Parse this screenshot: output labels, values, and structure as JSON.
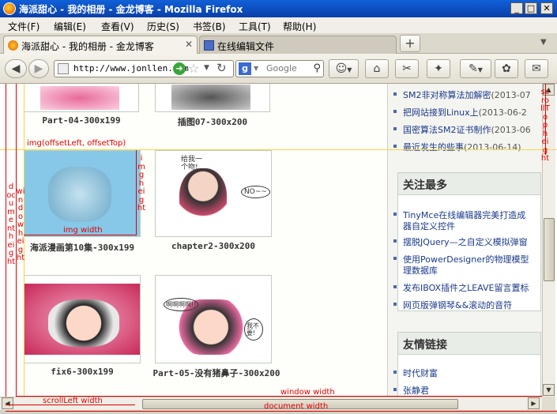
{
  "window": {
    "title": "海派甜心 - 我的相册 - 金龙博客 - Mozilla Firefox"
  },
  "menubar": [
    "文件(F)",
    "编辑(E)",
    "查看(V)",
    "历史(S)",
    "书签(B)",
    "工具(T)",
    "帮助(H)"
  ],
  "tabs": [
    {
      "label": "海派甜心 - 我的相册 - 金龙博客",
      "active": true
    },
    {
      "label": "在线编辑文件",
      "active": false
    }
  ],
  "navbar": {
    "url": "http://www.jonllen.com",
    "search_placeholder": "Google"
  },
  "gallery": {
    "captions": [
      "Part-04-300x199",
      "插图07-300x200",
      "海派漫画第10集-300x199",
      "chapter2-300x200",
      "fix6-300x199",
      "Part-05-没有猪鼻子-300x200"
    ],
    "speech": [
      "给我一个吻!",
      "NO~~",
      "啊啊啊啊!!",
      "我不要!"
    ]
  },
  "sidebar": {
    "recent": [
      {
        "title": "SM2非对称算法加解密",
        "date": "(2013-07"
      },
      {
        "title": "把网站接到Linux上",
        "date": "(2013-06-2"
      },
      {
        "title": "国密算法SM2证书制作",
        "date": "(2013-06"
      },
      {
        "title": "最近发生的些事",
        "date": "(2013-06-14)"
      }
    ],
    "popular_title": "关注最多",
    "popular": [
      "TinyMce在线编辑器完美打造成",
      "器自定义控件",
      "摆脱JQuery—之自定义模拟弹窗",
      "使用PowerDesigner的物理模型",
      "理数据库",
      "发布IBOX插件之LEAVE留言置标",
      "网页版弹钢琴&&滚动的音符"
    ],
    "links_title": "友情链接",
    "links": [
      "时代财富",
      "张静君"
    ]
  },
  "annotations": {
    "img_offset": "img(offsetLeft, offsetTop)",
    "img_height": "img height",
    "img_width": "img width",
    "document_height": "document height",
    "window_height": "window height",
    "scrolltop_height": "scrollTop height",
    "window_width": "window width",
    "scrollleft_width": "scrollLeft width",
    "document_width": "document width"
  },
  "colors": {
    "annotation": "#e00000",
    "highlight": "#87c8e8",
    "titlebar": "#0a3fa8"
  }
}
